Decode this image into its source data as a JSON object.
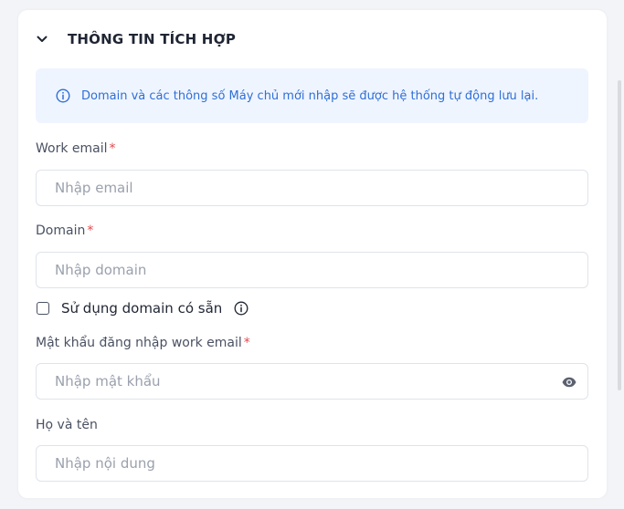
{
  "section": {
    "title": "THÔNG TIN TÍCH HỢP"
  },
  "notice": {
    "text": "Domain và các thông số Máy chủ mới nhập sẽ được hệ thống tự động lưu lại."
  },
  "fields": {
    "work_email": {
      "label": "Work email",
      "required_mark": "*",
      "placeholder": "Nhập email",
      "value": ""
    },
    "domain": {
      "label": "Domain",
      "required_mark": "*",
      "placeholder": "Nhập domain",
      "value": ""
    },
    "use_existing_domain": {
      "label": "Sử dụng domain có sẵn",
      "checked": false
    },
    "password": {
      "label": "Mật khẩu đăng nhập work email",
      "required_mark": "*",
      "placeholder": "Nhập mật khẩu",
      "value": ""
    },
    "full_name": {
      "label": "Họ và tên",
      "placeholder": "Nhập nội dung",
      "value": ""
    }
  },
  "icons": {
    "collapse": "chevron-down-icon",
    "notice": "info-circle-icon",
    "checkbox_info": "info-circle-icon",
    "password_toggle": "eye-icon"
  },
  "colors": {
    "notice_bg": "#eff5ff",
    "notice_text": "#2f6fd6",
    "required": "#e5484d",
    "title": "#1f2533"
  }
}
